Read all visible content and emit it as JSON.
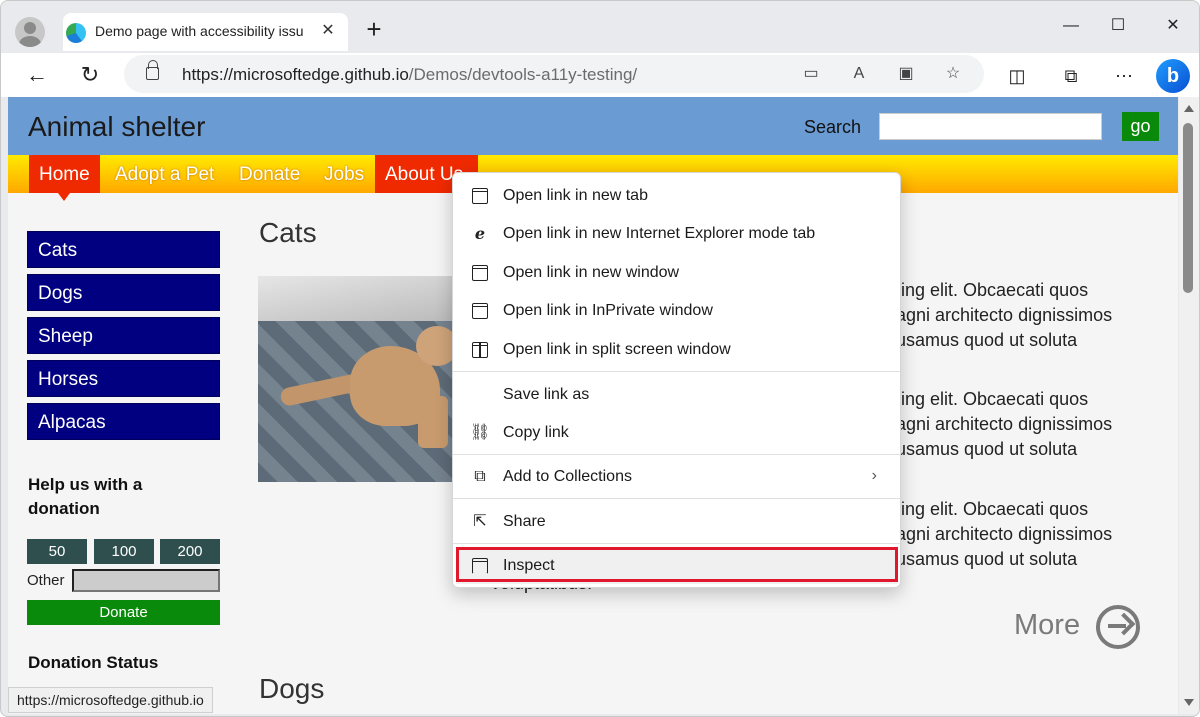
{
  "browser": {
    "tab_title": "Demo page with accessibility issu",
    "tab_close": "✕",
    "new_tab": "+",
    "url_host": "https://microsoftedge.github.io",
    "url_path": "/Demos/devtools-a11y-testing/",
    "window_controls": {
      "minimize": "—",
      "maximize": "☐",
      "close": "✕"
    },
    "icons": [
      "back-icon",
      "refresh-icon",
      "lock-icon",
      "app-available-icon",
      "read-aloud-icon",
      "immersive-reader-icon",
      "favorites-icon",
      "split-screen-icon",
      "collections-icon",
      "more-icon",
      "bing-copilot-icon"
    ]
  },
  "site": {
    "title": "Animal shelter",
    "search_label": "Search",
    "search_value": "",
    "go_label": "go",
    "nav": [
      "Home",
      "Adopt a Pet",
      "Donate",
      "Jobs",
      "About Us"
    ],
    "sidebar": [
      "Cats",
      "Dogs",
      "Sheep",
      "Horses",
      "Alpacas"
    ],
    "help_title": "Help us with a donation",
    "amounts": [
      "50",
      "100",
      "200"
    ],
    "other_label": "Other",
    "other_value": "",
    "donate_label": "Donate",
    "donation_status": "Donation Status",
    "cats_title": "Cats",
    "paragraphs": [
      [
        "ting elit. Obcaecati quos",
        "agni architecto dignissimos",
        "usamus quod ut soluta"
      ],
      [
        "ting elit. Obcaecati quos",
        "agni architecto dignissimos",
        "usamus quod ut soluta"
      ],
      [
        "ting elit. Obcaecati quos",
        "agni architecto dignissimos",
        "usamus quod ut soluta"
      ]
    ],
    "para_tail": "voluptatibus.",
    "more_label": "More",
    "dogs_title": "Dogs",
    "status_url": "https://microsoftedge.github.io"
  },
  "context_menu": {
    "items": [
      {
        "label": "Open link in new tab",
        "icon": "new-tab-icon"
      },
      {
        "label": "Open link in new Internet Explorer mode tab",
        "icon": "ie-mode-icon"
      },
      {
        "label": "Open link in new window",
        "icon": "new-window-icon"
      },
      {
        "label": "Open link in InPrivate window",
        "icon": "inprivate-icon"
      },
      {
        "label": "Open link in split screen window",
        "icon": "split-screen-icon"
      },
      {
        "label": "Save link as",
        "icon": ""
      },
      {
        "label": "Copy link",
        "icon": "link-icon"
      },
      {
        "label": "Add to Collections",
        "icon": "collections-icon"
      },
      {
        "label": "Share",
        "icon": "share-icon"
      },
      {
        "label": "Inspect",
        "icon": "inspect-icon"
      }
    ],
    "highlight_color": "#e0182b"
  },
  "colors": {
    "header": "#6a9bd3",
    "nav_active": "#f02a00",
    "sidebar": "#000080",
    "go_button": "#0a8a0a",
    "amount_buttons": "#2f4f4f"
  }
}
